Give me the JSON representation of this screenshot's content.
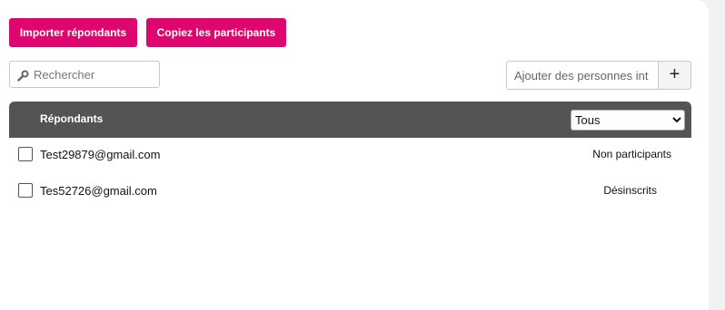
{
  "toolbar": {
    "import_label": "Importer répondants",
    "copy_label": "Copiez les participants"
  },
  "search": {
    "placeholder": "Rechercher",
    "icon": "search-icon"
  },
  "add_people": {
    "placeholder": "Ajouter des personnes int",
    "plus_label": "+"
  },
  "table": {
    "header": "Répondants",
    "filter": {
      "selected": "Tous"
    },
    "rows": [
      {
        "email": "Test29879@gmail.com",
        "status": "Non participants"
      },
      {
        "email": "Tes52726@gmail.com",
        "status": "Désinscrits"
      }
    ]
  },
  "colors": {
    "accent": "#e0066f",
    "header_bg": "#545454"
  }
}
